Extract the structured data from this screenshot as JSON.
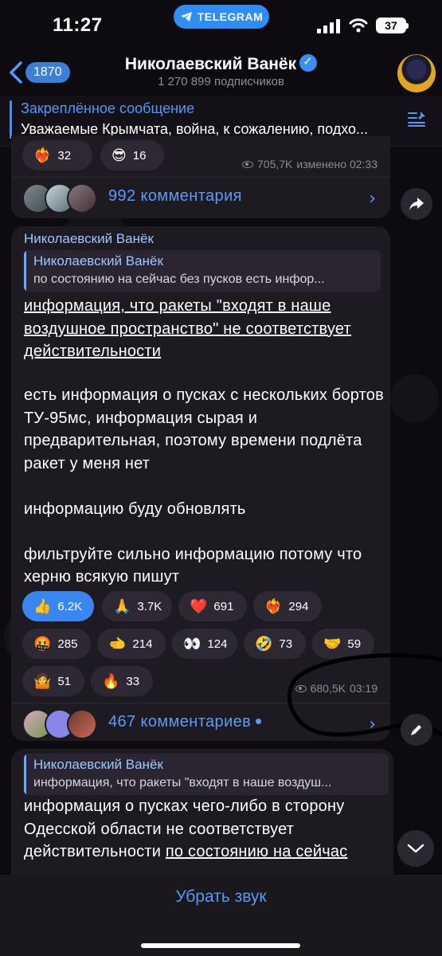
{
  "status_bar": {
    "time": "11:27",
    "app_pill": "TELEGRAM",
    "battery": "37"
  },
  "header": {
    "back_count": "1870",
    "title": "Николаевский Ванёк",
    "subscribers": "1 270 899 подписчиков"
  },
  "pinned": {
    "title": "Закреплённое сообщение",
    "text": "Уважаемые Крымчата, война, к сожалению, подхо..."
  },
  "post1": {
    "reactions": [
      {
        "emoji": "❤️‍🔥",
        "count": "32"
      },
      {
        "emoji": "😎",
        "count": "16"
      }
    ],
    "views": "705,7K",
    "edited": "изменено 02:33",
    "comments": "992 комментария"
  },
  "post2": {
    "author": "Николаевский Ванёк",
    "quote_author": "Николаевский Ванёк",
    "quote_text": "по состоянию на сейчас без пусков есть инфор...",
    "text_underlined": "информация, что ракеты \"входят в наше воздушное пространство\" не соответствует действительности",
    "text_body": "есть информация о пусках с нескольких бортов ТУ-95мс, информация сырая и предварительная, поэтому времени подлёта ракет у меня нет\n\nинформацию буду обновлять\n\nфильтруйте сильно информацию потому что херню всякую пишут",
    "reactions": [
      {
        "emoji": "👍",
        "count": "6.2K",
        "active": true
      },
      {
        "emoji": "🙏",
        "count": "3.7K"
      },
      {
        "emoji": "❤️",
        "count": "691"
      },
      {
        "emoji": "❤️‍🔥",
        "count": "294"
      },
      {
        "emoji": "🤬",
        "count": "285"
      },
      {
        "emoji": "🫲",
        "count": "214"
      },
      {
        "emoji": "👀",
        "count": "124"
      },
      {
        "emoji": "🤣",
        "count": "73"
      },
      {
        "emoji": "🤝",
        "count": "59"
      },
      {
        "emoji": "🤷",
        "count": "51"
      },
      {
        "emoji": "🔥",
        "count": "33"
      }
    ],
    "views": "680,5K",
    "time": "03:19",
    "comments": "467 комментариев"
  },
  "post3": {
    "quote_author": "Николаевский Ванёк",
    "quote_text": "информация, что ракеты \"входят в наше воздуш...",
    "text_a": "информация о пусках чего-либо в сторону Одесской области не соответствует действительности ",
    "text_b": "по состоянию на сейчас"
  },
  "bottom": {
    "mute": "Убрать звук"
  },
  "colors": {
    "accent": "#4f9af5",
    "bubble": "#1e1a22",
    "reaction_active": "#3a86f0"
  }
}
